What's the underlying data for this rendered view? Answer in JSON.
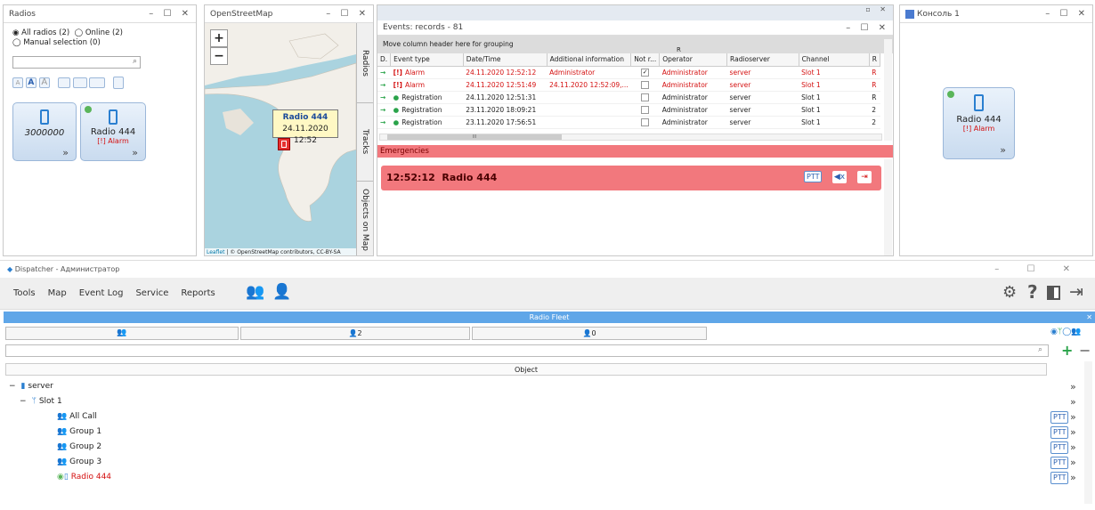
{
  "radios_panel": {
    "title": "Radios",
    "filter_all": "All radios (2)",
    "filter_online": "Online (2)",
    "filter_manual": "Manual selection (0)",
    "tile1": {
      "name": "3000000"
    },
    "tile2": {
      "name": "Radio 444",
      "status": "[!] Alarm"
    }
  },
  "map_panel": {
    "title": "OpenStreetMap",
    "zoom_in": "+",
    "zoom_out": "−",
    "popup_name": "Radio 444",
    "popup_time": "24.11.2020 12:52",
    "attribution_leaflet": "Leaflet",
    "attribution_text": "| © OpenStreetMap contributors, CC-BY-SA",
    "side_tabs": [
      "Radios",
      "Tracks",
      "Objects on Map"
    ]
  },
  "events_panel": {
    "title": "Events: records - 81",
    "grouping_hint": "Move column header here for grouping",
    "sort_marker": "R",
    "columns": [
      "D.",
      "Event type",
      "Date/Time",
      "Additional information",
      "Not r...",
      "Operator",
      "Radioserver",
      "Channel",
      "R"
    ],
    "rows": [
      {
        "type": "Alarm",
        "datetime": "24.11.2020 12:52:12",
        "info": "Administrator",
        "checked": true,
        "operator": "Administrator",
        "server": "server",
        "channel": "Slot 1",
        "r": "R",
        "alarm": true
      },
      {
        "type": "Alarm",
        "datetime": "24.11.2020 12:51:49",
        "info": "24.11.2020 12:52:09,...",
        "checked": false,
        "operator": "Administrator",
        "server": "server",
        "channel": "Slot 1",
        "r": "R",
        "alarm": true
      },
      {
        "type": "Registration",
        "datetime": "24.11.2020 12:51:31",
        "info": "",
        "checked": false,
        "operator": "Administrator",
        "server": "server",
        "channel": "Slot 1",
        "r": "R",
        "alarm": false
      },
      {
        "type": "Registration",
        "datetime": "23.11.2020 18:09:21",
        "info": "",
        "checked": false,
        "operator": "Administrator",
        "server": "server",
        "channel": "Slot 1",
        "r": "2",
        "alarm": false
      },
      {
        "type": "Registration",
        "datetime": "23.11.2020 17:56:51",
        "info": "",
        "checked": false,
        "operator": "Administrator",
        "server": "server",
        "channel": "Slot 1",
        "r": "2",
        "alarm": false
      }
    ],
    "scroll_marker": "III",
    "emergencies_label": "Emergencies",
    "emergency_text": "12:52:12  Radio 444",
    "ptt": "PTT"
  },
  "console_panel": {
    "title": "Консоль 1",
    "tile_name": "Radio 444",
    "tile_status": "[!] Alarm"
  },
  "app": {
    "title": "Dispatcher - Администратор",
    "menu": [
      "Tools",
      "Map",
      "Event Log",
      "Service",
      "Reports"
    ],
    "fleet_title": "Radio Fleet",
    "fleet_tab2_count": "2",
    "fleet_tab3_count": "0",
    "object_header": "Object",
    "tree": [
      {
        "label": "server",
        "level": 0,
        "toggle": "−"
      },
      {
        "label": "Slot 1",
        "level": 1,
        "toggle": "−"
      },
      {
        "label": "All Call",
        "level": 2
      },
      {
        "label": "Group 1",
        "level": 2
      },
      {
        "label": "Group 2",
        "level": 2
      },
      {
        "label": "Group 3",
        "level": 2
      },
      {
        "label": "Radio 444",
        "level": 2,
        "alarm": true
      }
    ],
    "ptt": "PTT",
    "more": "»"
  },
  "colors": {
    "alarm": "#d41010",
    "accent": "#3b8fd9",
    "emergency_bg": "#f2787d",
    "fleet_bar": "#5fa6e8",
    "toolbar_bg": "#efefef"
  }
}
